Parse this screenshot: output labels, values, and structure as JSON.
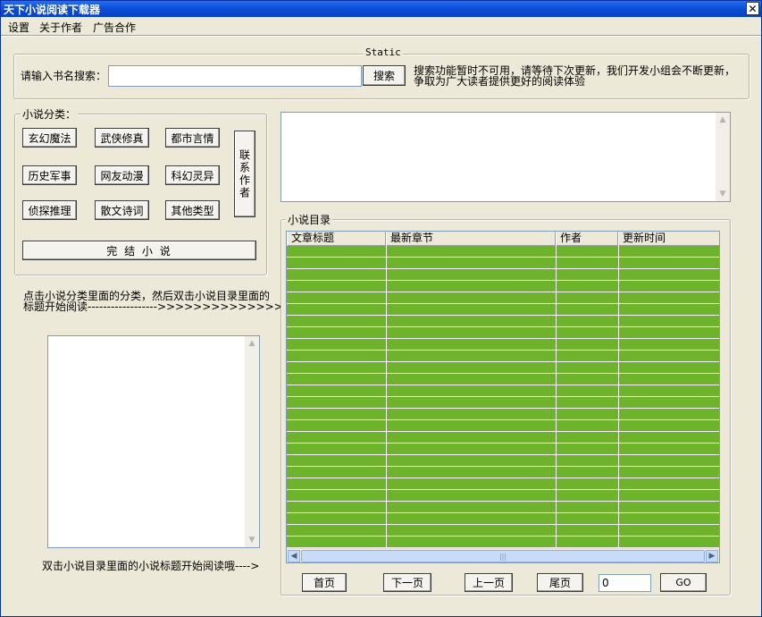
{
  "window": {
    "title": "天下小说阅读下载器",
    "close_glyph": "✕"
  },
  "menu": {
    "items": [
      "设置",
      "关于作者",
      "广告合作"
    ]
  },
  "search": {
    "group_title": "Static",
    "label": "请输入书名搜索：",
    "value": "",
    "button": "搜索",
    "notice_line1": "搜索功能暂时不可用，请等待下次更新，我们开发小组会不断更新，",
    "notice_line2": "争取为广大读者提供更好的阅读体验"
  },
  "categories": {
    "group_title": "小说分类：",
    "buttons": [
      "玄幻魔法",
      "武侠修真",
      "都市言情",
      "历史军事",
      "网友动漫",
      "科幻灵异",
      "侦探推理",
      "散文诗词",
      "其他类型"
    ],
    "contact_button": "联系作者",
    "finished_button": "完  结  小  说"
  },
  "hints": {
    "instruction_line1": "点击小说分类里面的分类，然后双击小说目录里面的",
    "instruction_line2": "标题开始阅读------------------>>>>>>>>>>>>>>",
    "bottom_hint": "双击小说目录里面的小说标题开始阅读哦---->"
  },
  "catalog": {
    "group_title": "小说目录",
    "columns": [
      "文章标题",
      "最新章节",
      "作者",
      "更新时间"
    ],
    "row_color": "#6db32b"
  },
  "pager": {
    "first": "首页",
    "next": "下一页",
    "prev": "上一页",
    "last": "尾页",
    "page_value": "0",
    "go": "GO"
  }
}
